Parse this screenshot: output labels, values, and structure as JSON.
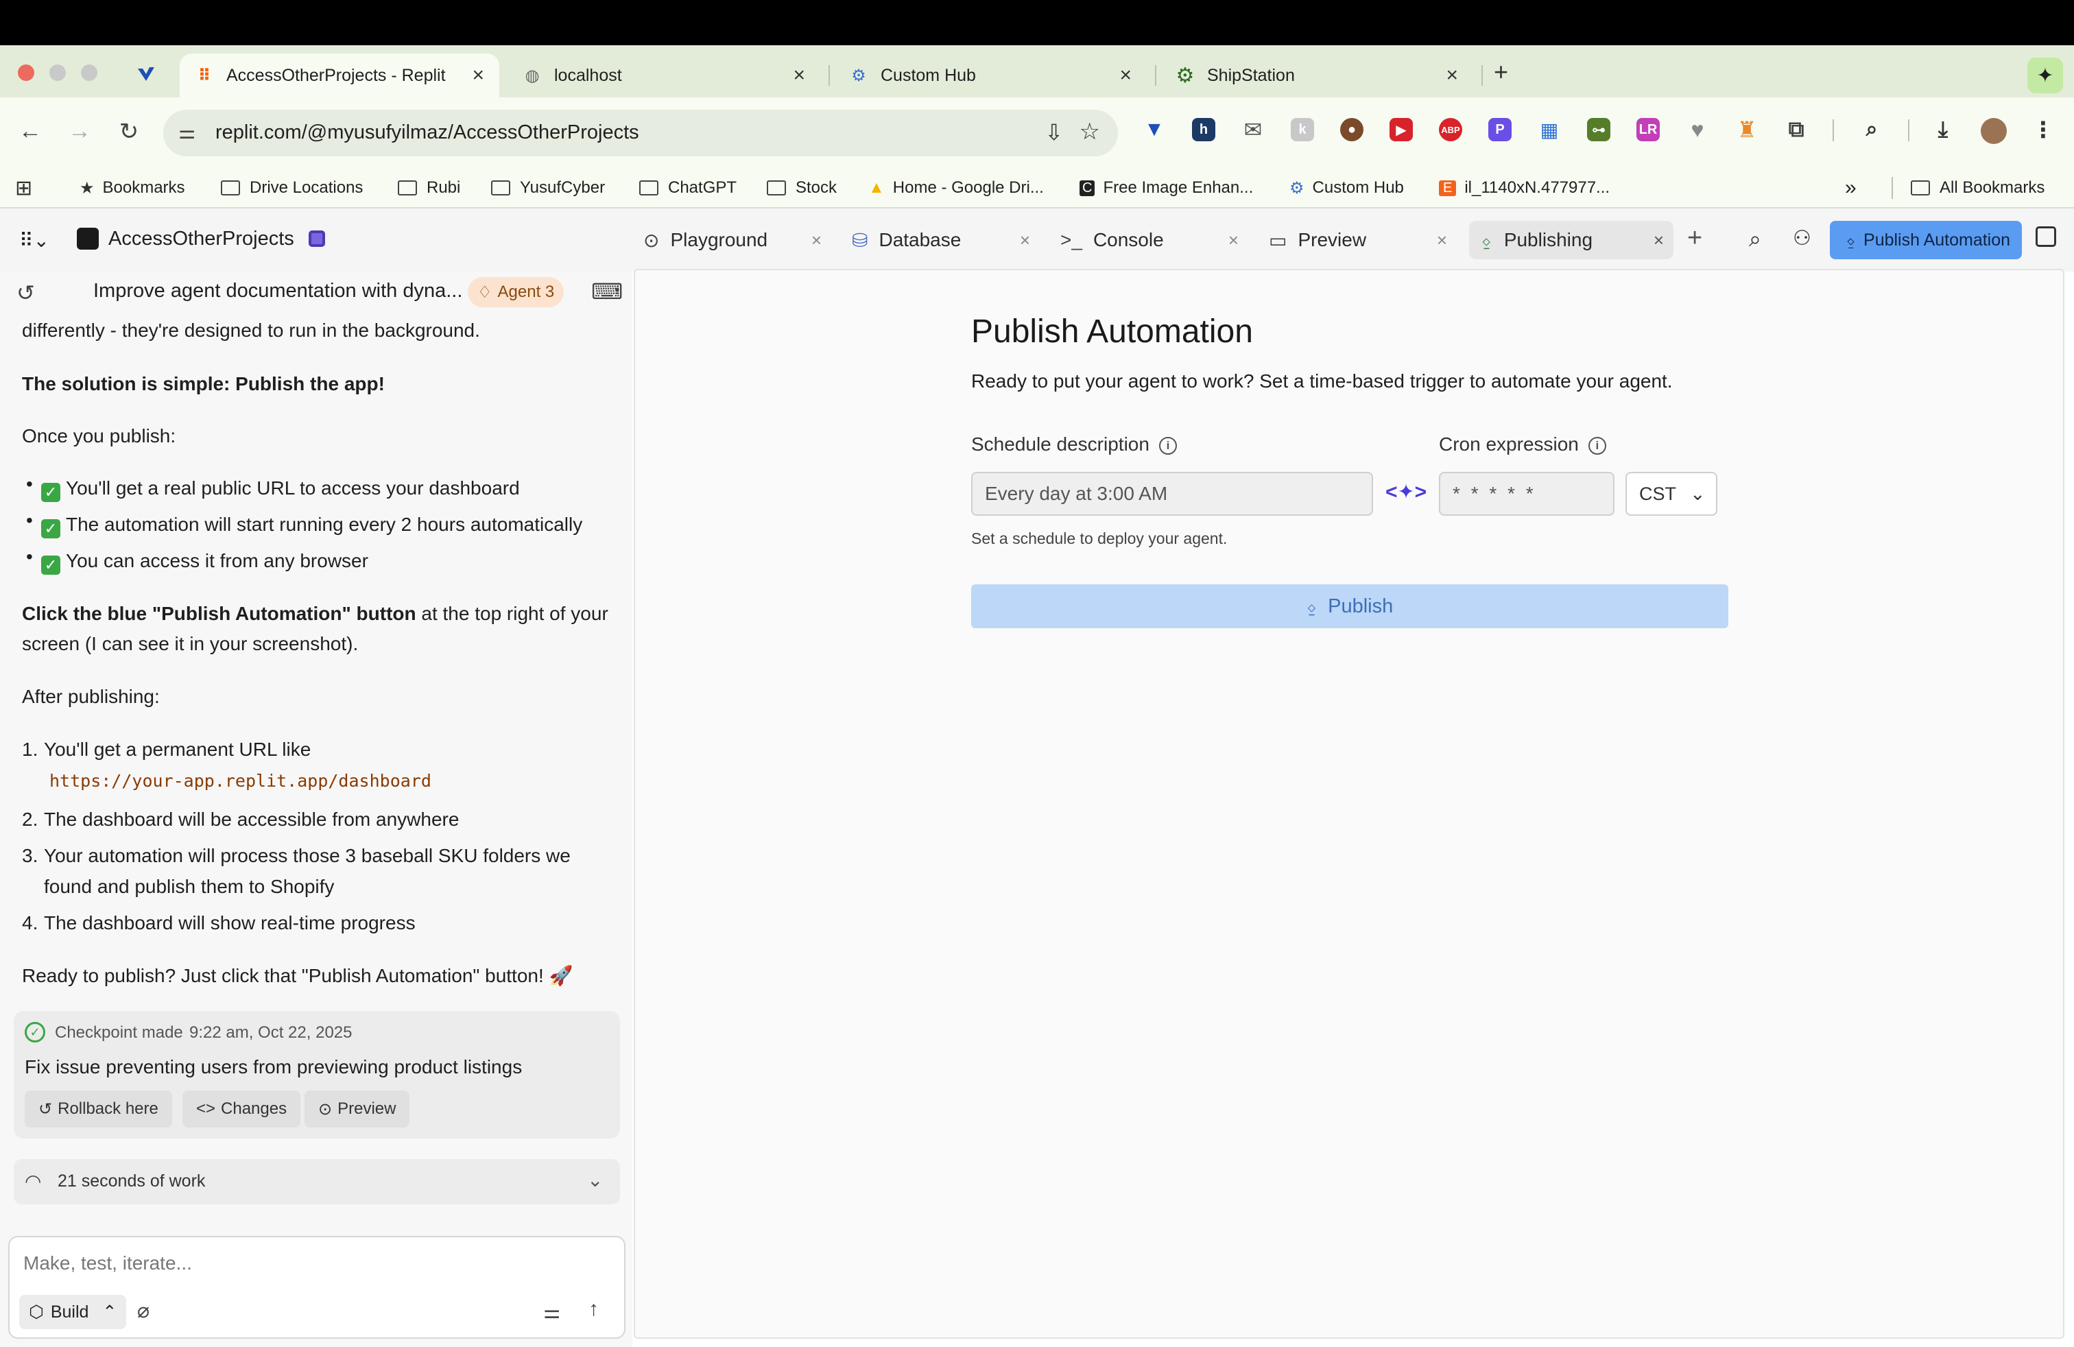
{
  "browser": {
    "tabs": [
      {
        "title": "AccessOtherProjects - Replit",
        "active": true
      },
      {
        "title": "localhost"
      },
      {
        "title": "Custom Hub"
      },
      {
        "title": "ShipStation"
      }
    ],
    "url": "replit.com/@myusufyilmaz/AccessOtherProjects",
    "bookmarks": [
      "Bookmarks",
      "Drive Locations",
      "Rubi",
      "YusufCyber",
      "ChatGPT",
      "Stock",
      "Home - Google Dri...",
      "Free Image Enhan...",
      "Custom Hub",
      "il_1140xN.477977..."
    ],
    "all_bookmarks": "All Bookmarks",
    "more_glyph": "»",
    "new_tab_glyph": "+"
  },
  "app": {
    "project_name": "AccessOtherProjects",
    "tabs": [
      {
        "label": "Playground",
        "icon": "play-circle-icon"
      },
      {
        "label": "Database",
        "icon": "database-icon"
      },
      {
        "label": "Console",
        "icon": "terminal-icon"
      },
      {
        "label": "Preview",
        "icon": "monitor-icon"
      },
      {
        "label": "Publishing",
        "icon": "publishing-icon",
        "active": true
      }
    ],
    "publish_automation_button": "Publish Automation"
  },
  "chat": {
    "thread_title": "Improve agent documentation with dyna...",
    "agent_badge": "Agent 3",
    "line_1": "differently - they're designed to run in the background.",
    "solution": "The solution is simple: Publish the app!",
    "once_publish": "Once you publish:",
    "benefits": [
      "You'll get a real public URL to access your dashboard",
      "The automation will start running every 2 hours automatically",
      "You can access it from any browser"
    ],
    "click_bold": "Click the blue \"Publish Automation\" button",
    "click_rest": " at the top right of your",
    "click_line2": "screen (I can see it in your screenshot).",
    "after_publishing": "After publishing:",
    "steps": [
      {
        "num": "1.",
        "text": "You'll get a permanent URL like"
      },
      {
        "num": "2.",
        "text": "The dashboard will be accessible from anywhere"
      },
      {
        "num": "3.",
        "text": "Your automation will process those 3 baseball SKU folders we"
      },
      {
        "num": "4.",
        "text": "The dashboard will show real-time progress"
      }
    ],
    "step1_code": "https://your-app.replit.app/dashboard",
    "step3_line2": "found and publish them to Shopify",
    "ready": "Ready to publish? Just click that \"Publish Automation\" button! 🚀",
    "checkpoint": {
      "label": "Checkpoint made",
      "time": "9:22 am, Oct 22, 2025",
      "description": "Fix issue preventing users from previewing product listings",
      "actions": [
        "Rollback here",
        "Changes",
        "Preview"
      ]
    },
    "work_summary": "21 seconds of work",
    "input_placeholder": "Make, test, iterate...",
    "build_label": "Build"
  },
  "publish": {
    "title": "Publish Automation",
    "subtitle": "Ready to put your agent to work? Set a time-based trigger to automate your agent.",
    "schedule_label": "Schedule description",
    "schedule_placeholder": "Every day at 3:00 AM",
    "cron_label": "Cron expression",
    "cron_placeholder": "* * * * *",
    "timezone": "CST",
    "hint": "Set a schedule to deploy your agent.",
    "publish_button": "Publish"
  },
  "colors": {
    "accent_blue": "#5a9cf2",
    "publish_disabled": "#bcd7f7",
    "agent_badge_bg": "#fbe3cf",
    "check_green": "#3aa745"
  }
}
